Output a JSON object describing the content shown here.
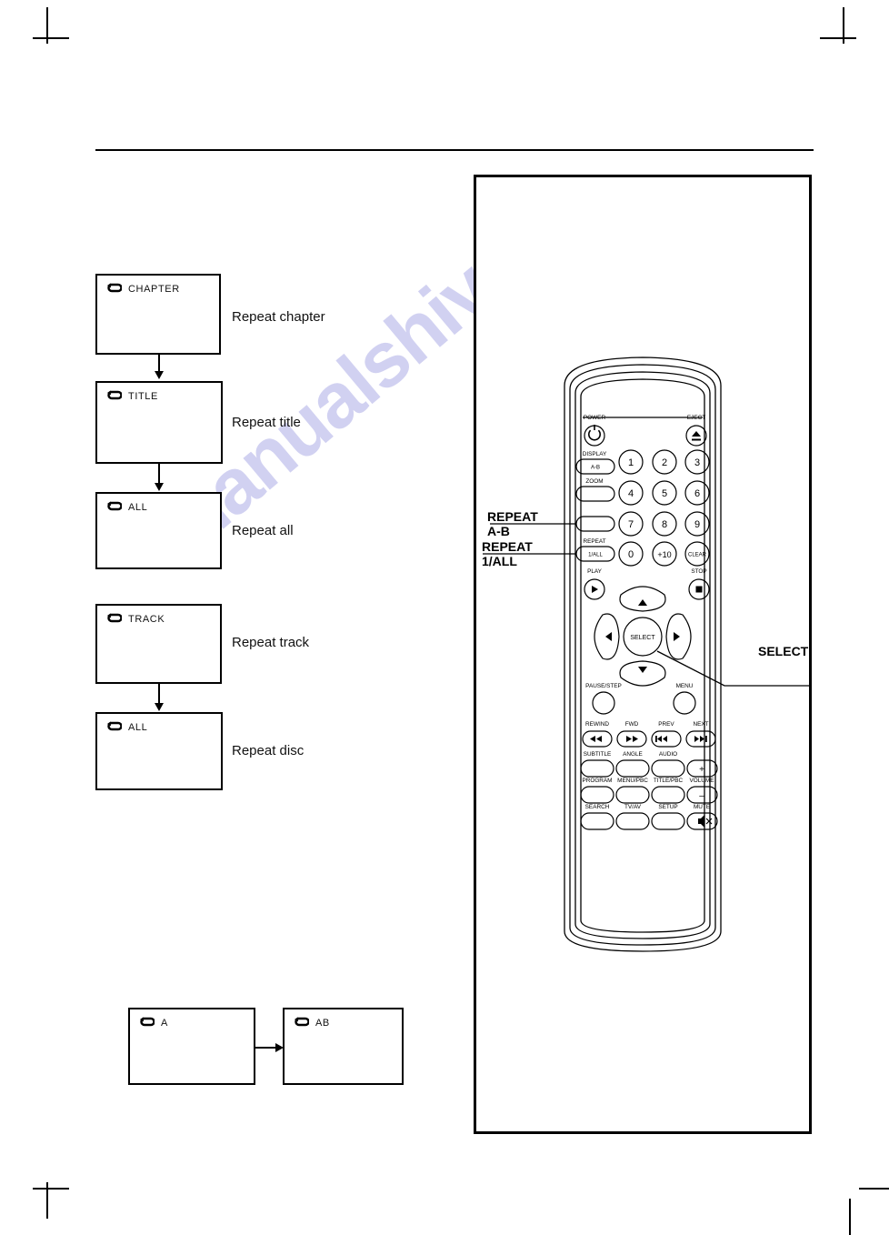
{
  "page": {
    "watermark_text": "manualshive",
    "background_color": "#ffffff",
    "line_color": "#000000",
    "watermark_color": "#c9c9ef"
  },
  "flow_dvd": {
    "items": [
      {
        "osd_icon": "repeat-icon",
        "osd_text": "CHAPTER",
        "caption": "Repeat chapter",
        "arrow_below": true
      },
      {
        "osd_icon": "repeat-icon",
        "osd_text": "TITLE",
        "caption": "Repeat title",
        "arrow_below": true
      },
      {
        "osd_icon": "repeat-icon",
        "osd_text": "ALL",
        "caption": "Repeat all",
        "arrow_below": false
      }
    ]
  },
  "flow_cd": {
    "items": [
      {
        "osd_icon": "repeat-icon",
        "osd_text": "TRACK",
        "caption": "Repeat track",
        "arrow_below": true
      },
      {
        "osd_icon": "repeat-icon",
        "osd_text": "ALL",
        "caption": "Repeat disc",
        "arrow_below": false
      }
    ]
  },
  "flow_ab": {
    "items": [
      {
        "osd_icon": "repeat-icon",
        "osd_text": "A"
      },
      {
        "osd_icon": "repeat-icon",
        "osd_text": "AB"
      }
    ]
  },
  "remote": {
    "callouts": {
      "repeat_ab": "REPEAT\nA-B",
      "repeat_1all": "REPEAT\n1/ALL",
      "select": "SELECT"
    },
    "buttons": {
      "power": {
        "label": "POWER",
        "icon": "power-icon"
      },
      "eject": {
        "label": "EJECT",
        "icon": "eject-icon"
      },
      "display": {
        "label": "DISPLAY"
      },
      "zoom": {
        "label": "ZOOM"
      },
      "ab": {
        "label": "A-B"
      },
      "repeat_caption": "REPEAT",
      "repeat_1all": {
        "label": "1/ALL"
      },
      "clear": {
        "label": "CLEAR"
      },
      "numbers": [
        "1",
        "2",
        "3",
        "4",
        "5",
        "6",
        "7",
        "8",
        "9",
        "0",
        "+10"
      ],
      "play": {
        "label": "PLAY",
        "icon": "play-icon"
      },
      "stop": {
        "label": "STOP",
        "icon": "stop-icon"
      },
      "select": {
        "label": "SELECT"
      },
      "up": {
        "icon": "arrow-up-icon"
      },
      "down": {
        "icon": "arrow-down-icon"
      },
      "left": {
        "icon": "arrow-left-icon"
      },
      "right": {
        "icon": "arrow-right-icon"
      },
      "pause_step": {
        "label": "PAUSE/STEP"
      },
      "menu": {
        "label": "MENU"
      },
      "rewind": {
        "label": "REWIND",
        "icon": "rewind-icon"
      },
      "forward": {
        "label": "FWD",
        "icon": "fast-forward-icon"
      },
      "prev": {
        "label": "PREV",
        "icon": "previous-icon"
      },
      "next": {
        "label": "NEXT",
        "icon": "next-icon"
      },
      "subtitle": {
        "label": "SUBTITLE"
      },
      "angle": {
        "label": "ANGLE"
      },
      "audio": {
        "label": "AUDIO"
      },
      "volume_up": {
        "label": "+"
      },
      "program": {
        "label": "PROGRAM"
      },
      "menu_pbc": {
        "label": "MENU/PBC"
      },
      "title": {
        "label": "TITLE/PBC"
      },
      "volume": {
        "label": "VOLUME"
      },
      "volume_down": {
        "label": "-"
      },
      "search": {
        "label": "SEARCH"
      },
      "tv_av": {
        "label": "TV/AV"
      },
      "setup": {
        "label": "SETUP"
      },
      "mute": {
        "label": "MUTE",
        "icon": "mute-icon"
      }
    }
  }
}
